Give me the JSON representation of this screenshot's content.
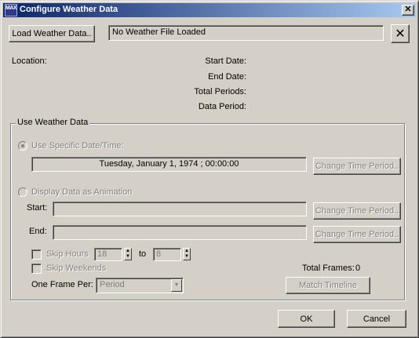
{
  "window": {
    "title": "Configure Weather Data",
    "app_icon_text": "MAX"
  },
  "top": {
    "load_button": "Load Weather Data..",
    "file_status": "No Weather File Loaded",
    "clear_button": "✕"
  },
  "info": {
    "location_label": "Location:",
    "start_date_label": "Start Date:",
    "end_date_label": "End Date:",
    "total_periods_label": "Total Periods:",
    "data_period_label": "Data Period:"
  },
  "group": {
    "legend": "Use Weather Data",
    "specific_radio_label": "Use Specific Date/Time:",
    "specific_datetime": "Tuesday, January 1, 1974 ; 00:00:00",
    "change_time_period": "Change Time Period..",
    "animation_radio_label": "Display Data as  Animation",
    "start_label": "Start:",
    "end_label": "End:",
    "start_value": "",
    "end_value": "",
    "skip_hours_label": "Skip Hours",
    "skip_hours_from": "18",
    "to_label": "to",
    "skip_hours_to": "8",
    "skip_weekends_label": "Skip Weekends",
    "one_frame_per_label": "One Frame Per:",
    "one_frame_per_value": "Period",
    "total_frames_label": "Total Frames:",
    "total_frames_value": "0",
    "match_timeline": "Match Timeline"
  },
  "footer": {
    "ok": "OK",
    "cancel": "Cancel"
  }
}
